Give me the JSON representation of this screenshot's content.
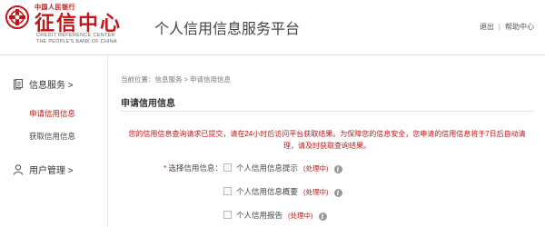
{
  "header": {
    "logo_top": "中国人民银行",
    "logo_main": "征信中心",
    "logo_en_line1": "CREDIT REFERENCE CENTER",
    "logo_en_line2": "THE PEOPLE'S BANK OF CHINA",
    "platform_title": "个人信用信息服务平台",
    "logout_label": "退出",
    "link_separator": "|",
    "help_label": "帮助中心"
  },
  "sidebar": {
    "info_service": {
      "label": "信息服务 >",
      "icon": "document-icon"
    },
    "items": [
      {
        "label": "申请信用信息",
        "active": true
      },
      {
        "label": "获取信用信息",
        "active": false
      }
    ],
    "user_management": {
      "label": "用户管理 >",
      "icon": "user-icon"
    }
  },
  "main": {
    "breadcrumb": "当前位置：信息服务 > 申请信用信息",
    "section_title": "申请信用信息",
    "notice": "您的信用信息查询请求已提交，请在24小时后访问平台获取结果。为保障您的信息安全，您申请的信用信息将于7日后自动清理，请及时获取查询结果。",
    "select_label": "选择信用信息：",
    "required_mark": "*",
    "options": [
      {
        "label": "个人信用信息提示",
        "status": "(处理中)",
        "checked": false
      },
      {
        "label": "个人信用信息概要",
        "status": "(处理中)",
        "checked": false
      },
      {
        "label": "个人信用报告",
        "status": "(处理中)",
        "checked": false
      }
    ],
    "info_icon_glyph": "i"
  },
  "colors": {
    "brand_red": "#c21515",
    "text": "#333333",
    "muted": "#777777"
  }
}
